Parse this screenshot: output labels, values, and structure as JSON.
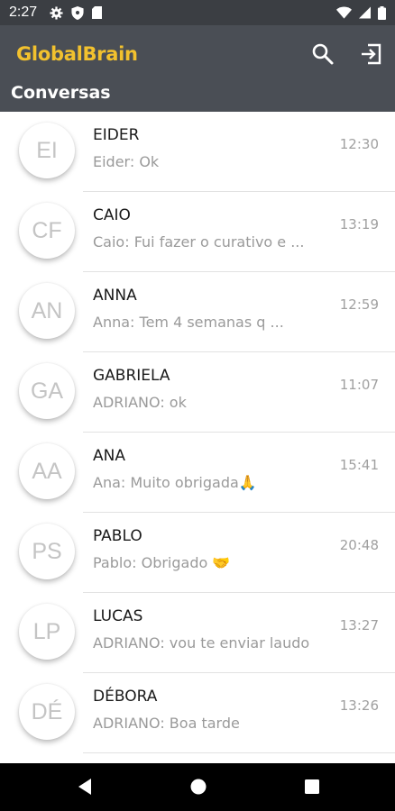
{
  "status_bar": {
    "time": "2:27",
    "icons": [
      "gear-icon",
      "shield-icon",
      "sim-icon",
      "wifi-icon",
      "signal-icon",
      "battery-icon"
    ]
  },
  "app_bar": {
    "title": "GlobalBrain",
    "section": "Conversas",
    "title_color": "#f2c12e",
    "actions": [
      "search-icon",
      "logout-icon"
    ]
  },
  "conversations": [
    {
      "initials": "EI",
      "name": "EIDER",
      "preview": "Eider: Ok",
      "time": "12:30"
    },
    {
      "initials": "CF",
      "name": "CAIO",
      "preview": "Caio: Fui fazer o curativo e ...",
      "time": "13:19"
    },
    {
      "initials": "AN",
      "name": "ANNA",
      "preview": "Anna: Tem 4 semanas q ...",
      "time": "12:59"
    },
    {
      "initials": "GA",
      "name": "GABRIELA",
      "preview": "ADRIANO: ok",
      "time": "11:07"
    },
    {
      "initials": "AA",
      "name": "ANA",
      "preview": "Ana: Muito obrigada🙏",
      "time": "15:41"
    },
    {
      "initials": "PS",
      "name": "PABLO",
      "preview": "Pablo: Obrigado 🤝",
      "time": "20:48"
    },
    {
      "initials": "LP",
      "name": "LUCAS",
      "preview": "ADRIANO: vou te enviar laudo",
      "time": "13:27"
    },
    {
      "initials": "DÉ",
      "name": "DÉBORA",
      "preview": "ADRIANO: Boa tarde",
      "time": "13:26"
    }
  ],
  "nav_bar": {
    "buttons": [
      "back-icon",
      "home-icon",
      "recents-icon"
    ]
  }
}
